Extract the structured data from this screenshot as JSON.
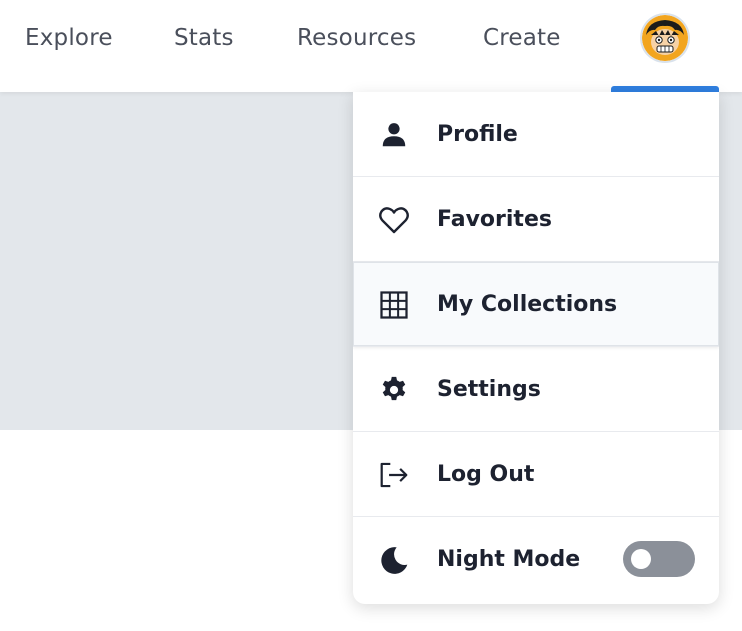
{
  "nav": {
    "links": [
      "Explore",
      "Stats",
      "Resources",
      "Create"
    ],
    "avatar_icon": "user-avatar-icon"
  },
  "menu": {
    "items": [
      {
        "label": "Profile",
        "icon": "person-icon"
      },
      {
        "label": "Favorites",
        "icon": "heart-icon"
      },
      {
        "label": "My Collections",
        "icon": "grid-icon"
      },
      {
        "label": "Settings",
        "icon": "gear-icon"
      },
      {
        "label": "Log Out",
        "icon": "logout-icon"
      },
      {
        "label": "Night Mode",
        "icon": "moon-icon"
      }
    ],
    "night_mode_enabled": false
  },
  "colors": {
    "accent": "#2f7fe0",
    "panel": "#e3e7eb",
    "toggle_off": "#8b9099",
    "text": "#1d2230"
  }
}
